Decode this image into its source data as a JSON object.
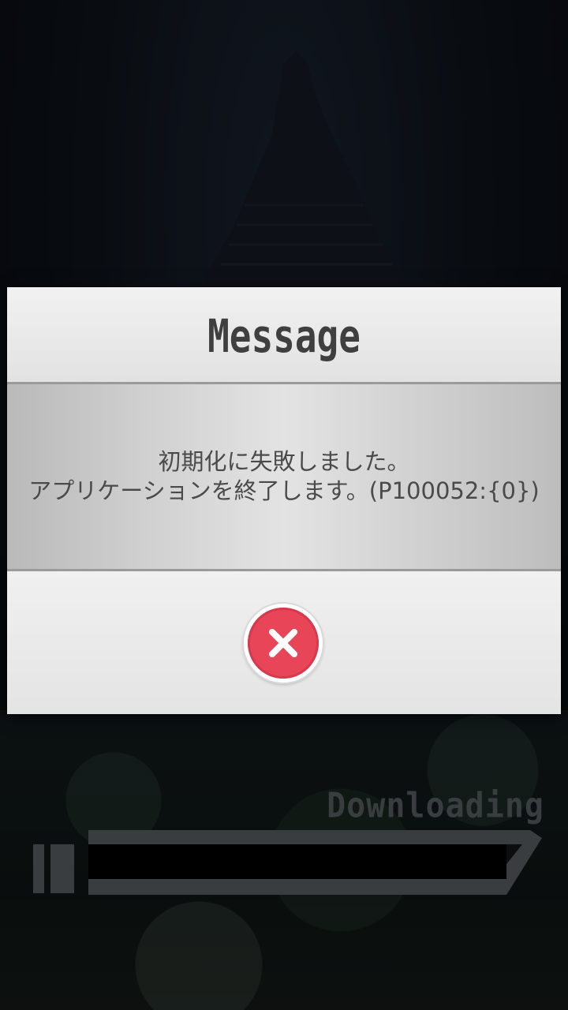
{
  "dialog": {
    "title": "Message",
    "message_line1": "初期化に失敗しました。",
    "message_line2": "アプリケーションを終了します。(P100052:{0})",
    "close_icon": "close-icon"
  },
  "loading": {
    "label": "Downloading"
  },
  "colors": {
    "close_button": "#e84558",
    "title_text": "#3f3f3f",
    "message_text": "#4a4a4a"
  }
}
